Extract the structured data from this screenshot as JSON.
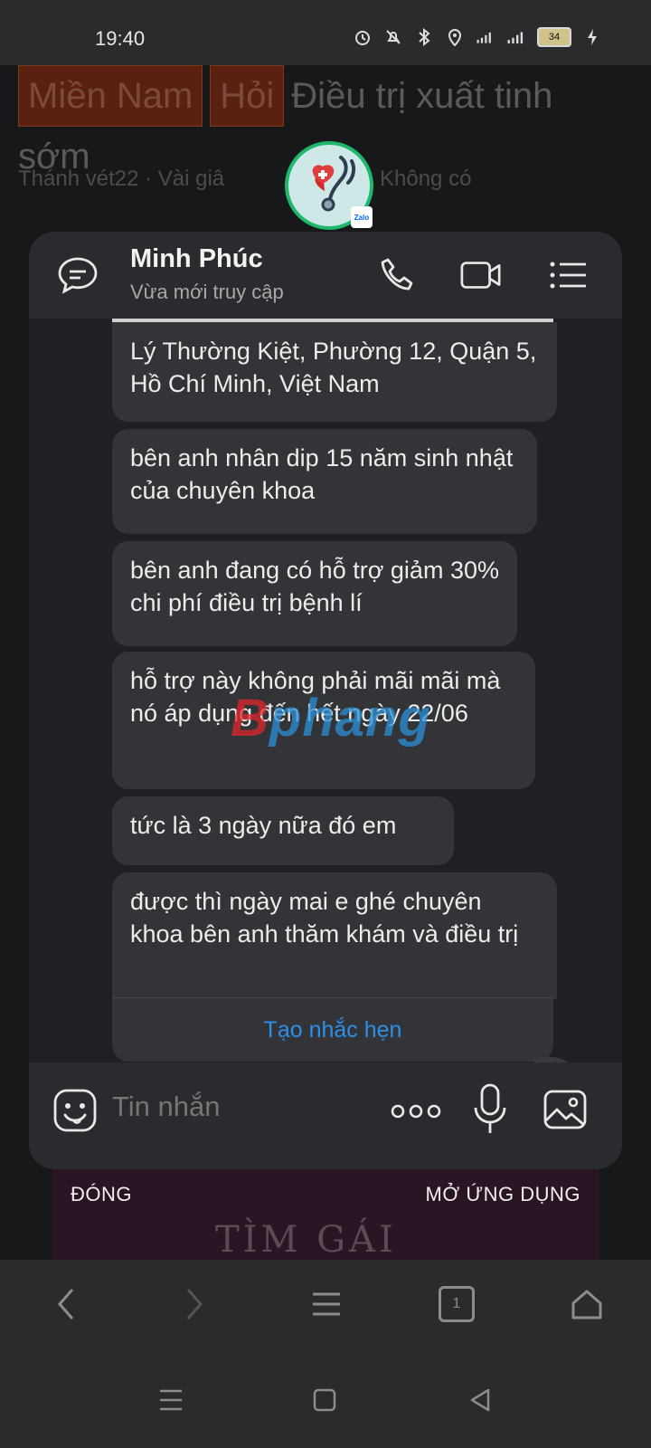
{
  "status_bar": {
    "time": "19:40",
    "battery": "34"
  },
  "background": {
    "tags": [
      "Miền Nam",
      "Hỏi"
    ],
    "title": "Điều trị xuất tinh sớm",
    "author": "Thánh vét22",
    "time": "Vài giâ",
    "tag_status": "Không có"
  },
  "chat": {
    "contact_name": "Minh Phúc",
    "contact_status": "Vừa mới truy cập",
    "messages": [
      "Lý Thường Kiệt, Phường 12, Quận 5, Hồ Chí Minh, Việt Nam",
      "bên anh nhân dip 15 năm sinh nhật của chuyên khoa",
      "bên anh đang có hỗ trợ giảm 30% chi phí điều trị bệnh lí",
      "hỗ trợ này không phải mãi mãi mà nó áp dụng đến hết ngày 22/06",
      "tức là 3 ngày nữa đó em",
      "được thì ngày mai e ghé chuyên khoa bên anh thăm khám và điều trị"
    ],
    "reminder_label": "Tạo nhắc hẹn",
    "composer_placeholder": "Tin nhắn",
    "zalo_badge": "Zalo"
  },
  "actions": {
    "close": "ĐÓNG",
    "open_app": "MỞ ỨNG DỤNG"
  },
  "browser": {
    "tab_count": "1"
  },
  "background_image_caption": "TÌM GÁI",
  "watermark": {
    "part1": "B",
    "part2": "phang"
  },
  "colors": {
    "accent": "#2f8ee8",
    "avatar_ring": "#1fb86a",
    "bubble": "#333437"
  }
}
